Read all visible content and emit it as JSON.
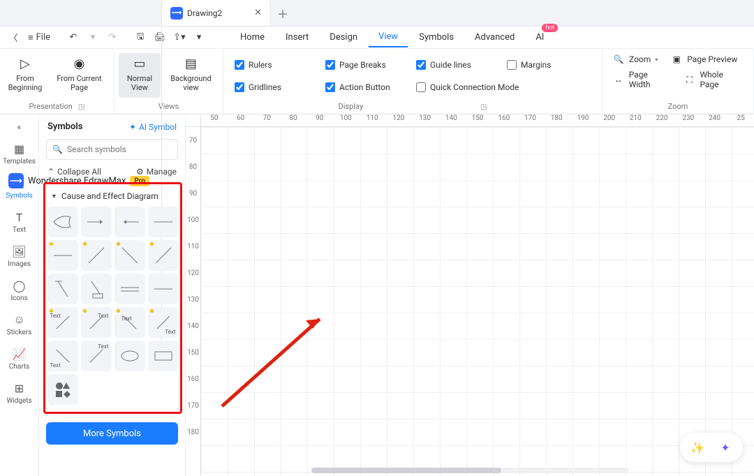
{
  "tabs": {
    "app_title": "Wondershare EdrawMax",
    "pro": "Pro",
    "doc_title": "Drawing2"
  },
  "toolbar": {
    "file": "File"
  },
  "menu": {
    "items": [
      "Home",
      "Insert",
      "Design",
      "View",
      "Symbols",
      "Advanced",
      "AI"
    ],
    "active_index": 3,
    "hot": "hot"
  },
  "ribbon": {
    "presentation": {
      "label": "Presentation",
      "from_beginning": "From\nBeginning",
      "from_current": "From Current\nPage"
    },
    "views": {
      "label": "Views",
      "normal": "Normal\nView",
      "background": "Background\nview"
    },
    "display": {
      "label": "Display",
      "rulers": "Rulers",
      "page_breaks": "Page Breaks",
      "guide": "Guide lines",
      "margins": "Margins",
      "gridlines": "Gridlines",
      "action": "Action Button",
      "quick": "Quick Connection Mode"
    },
    "zoom": {
      "label": "Zoom",
      "zoom": "Zoom",
      "preview": "Page Preview",
      "width": "Page Width",
      "whole": "Whole Page"
    }
  },
  "rail": {
    "items": [
      {
        "label": "Templates"
      },
      {
        "label": "Symbols"
      },
      {
        "label": "Text"
      },
      {
        "label": "Images"
      },
      {
        "label": "Icons"
      },
      {
        "label": "Stickers"
      },
      {
        "label": "Charts"
      },
      {
        "label": "Widgets"
      }
    ],
    "active_index": 1
  },
  "panel": {
    "title": "Symbols",
    "ai": "AI Symbol",
    "search_ph": "Search symbols",
    "collapse": "Collapse All",
    "manage": "Manage",
    "category": "Cause and Effect Diagram",
    "more": "More Symbols",
    "text_token": "Text"
  },
  "ruler": {
    "h": [
      "50",
      "60",
      "70",
      "80",
      "90",
      "100",
      "110",
      "120",
      "130",
      "140",
      "150",
      "160",
      "170",
      "180",
      "190",
      "200",
      "210",
      "220",
      "230",
      "240",
      "25"
    ],
    "v": [
      "70",
      "80",
      "90",
      "100",
      "110",
      "120",
      "130",
      "140",
      "150",
      "160",
      "170",
      "180"
    ]
  }
}
